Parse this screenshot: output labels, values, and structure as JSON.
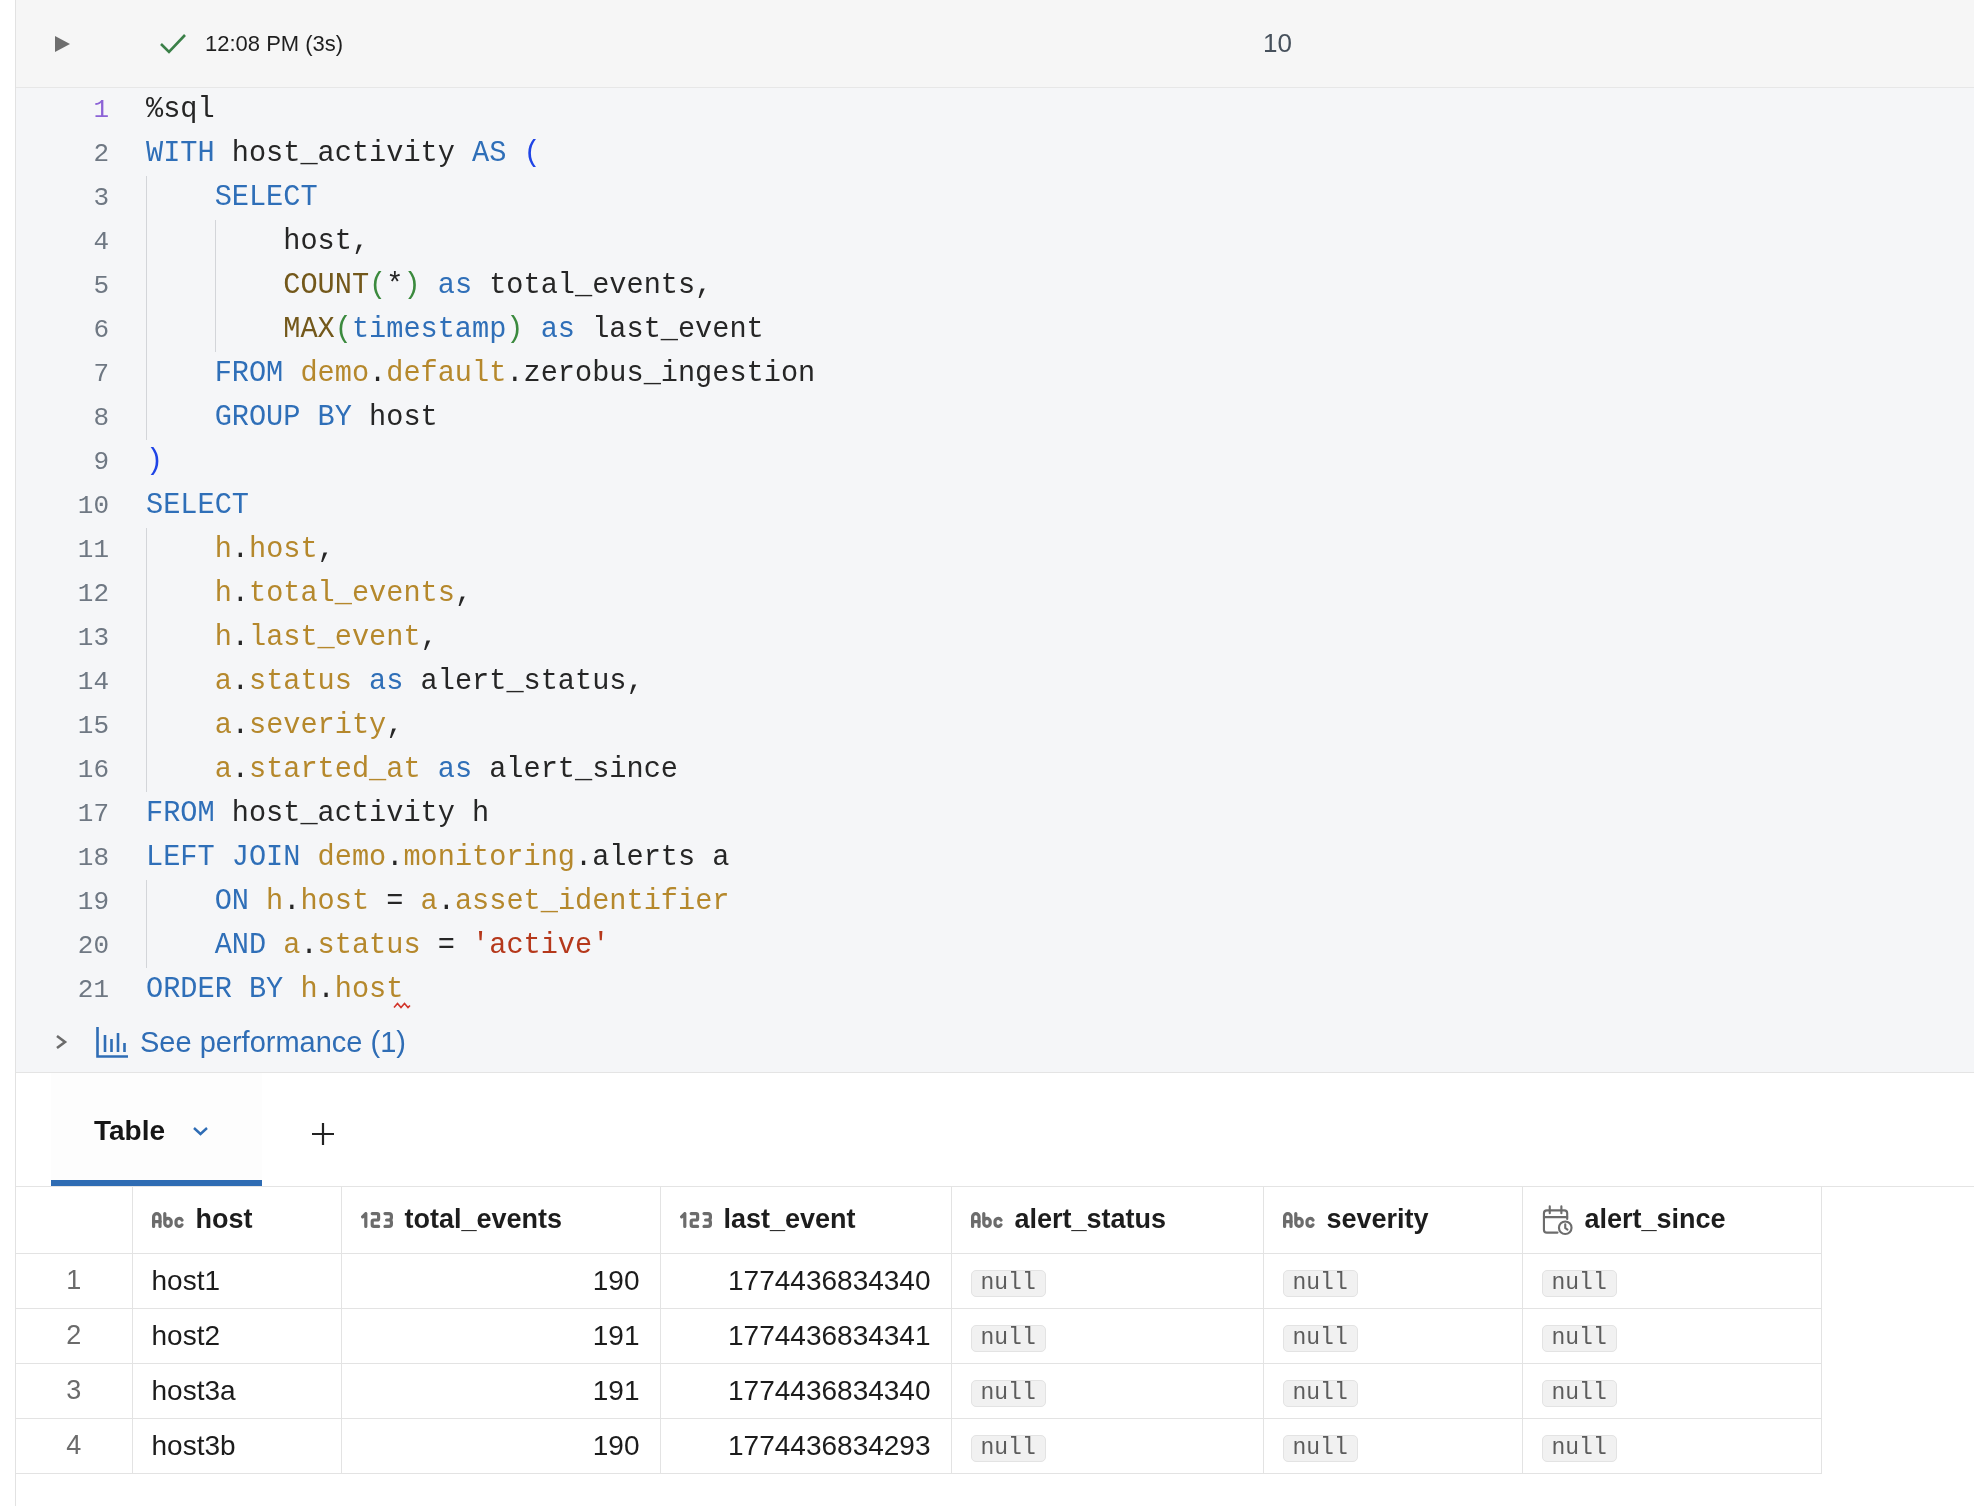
{
  "run_bar": {
    "success": true,
    "time": "12:08 PM (3s)",
    "trailing_text": "10"
  },
  "editor": {
    "lines": [
      {
        "number": "1",
        "highlighted": true,
        "error": false,
        "tokens": [
          {
            "kind": "plain",
            "text": "%sql"
          }
        ]
      },
      {
        "number": "2",
        "highlighted": false,
        "error": false,
        "tokens": [
          {
            "kind": "keyword",
            "text": "WITH"
          },
          {
            "kind": "plain",
            "text": " host_activity "
          },
          {
            "kind": "keyword",
            "text": "AS "
          },
          {
            "kind": "bracket",
            "text": "("
          }
        ]
      },
      {
        "number": "3",
        "highlighted": false,
        "error": false,
        "tokens": [
          {
            "kind": "indent"
          },
          {
            "kind": "keyword",
            "text": "SELECT"
          }
        ]
      },
      {
        "number": "4",
        "highlighted": false,
        "error": false,
        "tokens": [
          {
            "kind": "indent"
          },
          {
            "kind": "indent"
          },
          {
            "kind": "plain",
            "text": "host,"
          }
        ]
      },
      {
        "number": "5",
        "highlighted": false,
        "error": false,
        "tokens": [
          {
            "kind": "indent"
          },
          {
            "kind": "indent"
          },
          {
            "kind": "function",
            "text": "COUNT"
          },
          {
            "kind": "delimiter",
            "text": "("
          },
          {
            "kind": "plain",
            "text": "*"
          },
          {
            "kind": "delimiter",
            "text": ")"
          },
          {
            "kind": "keyword",
            "text": " as"
          },
          {
            "kind": "plain",
            "text": " total_events,"
          }
        ]
      },
      {
        "number": "6",
        "highlighted": false,
        "error": false,
        "tokens": [
          {
            "kind": "indent"
          },
          {
            "kind": "indent"
          },
          {
            "kind": "function",
            "text": "MAX"
          },
          {
            "kind": "delimiter",
            "text": "("
          },
          {
            "kind": "keyword",
            "text": "timestamp"
          },
          {
            "kind": "delimiter",
            "text": ")"
          },
          {
            "kind": "keyword",
            "text": " as"
          },
          {
            "kind": "plain",
            "text": " last_event"
          }
        ]
      },
      {
        "number": "7",
        "highlighted": false,
        "error": false,
        "tokens": [
          {
            "kind": "indent"
          },
          {
            "kind": "keyword",
            "text": "FROM "
          },
          {
            "kind": "name",
            "text": "demo"
          },
          {
            "kind": "plain",
            "text": "."
          },
          {
            "kind": "name",
            "text": "default"
          },
          {
            "kind": "plain",
            "text": ".zerobus_ingestion"
          }
        ]
      },
      {
        "number": "8",
        "highlighted": false,
        "error": false,
        "tokens": [
          {
            "kind": "indent"
          },
          {
            "kind": "keyword",
            "text": "GROUP BY"
          },
          {
            "kind": "plain",
            "text": " host"
          }
        ]
      },
      {
        "number": "9",
        "highlighted": false,
        "error": false,
        "tokens": [
          {
            "kind": "bracket",
            "text": ")"
          }
        ]
      },
      {
        "number": "10",
        "highlighted": false,
        "error": false,
        "tokens": [
          {
            "kind": "keyword",
            "text": "SELECT"
          }
        ]
      },
      {
        "number": "11",
        "highlighted": false,
        "error": false,
        "tokens": [
          {
            "kind": "indent"
          },
          {
            "kind": "name",
            "text": "h"
          },
          {
            "kind": "plain",
            "text": "."
          },
          {
            "kind": "name",
            "text": "host"
          },
          {
            "kind": "plain",
            "text": ","
          }
        ]
      },
      {
        "number": "12",
        "highlighted": false,
        "error": false,
        "tokens": [
          {
            "kind": "indent"
          },
          {
            "kind": "name",
            "text": "h"
          },
          {
            "kind": "plain",
            "text": "."
          },
          {
            "kind": "name",
            "text": "total_events"
          },
          {
            "kind": "plain",
            "text": ","
          }
        ]
      },
      {
        "number": "13",
        "highlighted": false,
        "error": false,
        "tokens": [
          {
            "kind": "indent"
          },
          {
            "kind": "name",
            "text": "h"
          },
          {
            "kind": "plain",
            "text": "."
          },
          {
            "kind": "name",
            "text": "last_event"
          },
          {
            "kind": "plain",
            "text": ","
          }
        ]
      },
      {
        "number": "14",
        "highlighted": false,
        "error": false,
        "tokens": [
          {
            "kind": "indent"
          },
          {
            "kind": "name",
            "text": "a"
          },
          {
            "kind": "plain",
            "text": "."
          },
          {
            "kind": "name",
            "text": "status"
          },
          {
            "kind": "keyword",
            "text": " as"
          },
          {
            "kind": "plain",
            "text": " alert_status,"
          }
        ]
      },
      {
        "number": "15",
        "highlighted": false,
        "error": false,
        "tokens": [
          {
            "kind": "indent"
          },
          {
            "kind": "name",
            "text": "a"
          },
          {
            "kind": "plain",
            "text": "."
          },
          {
            "kind": "name",
            "text": "severity"
          },
          {
            "kind": "plain",
            "text": ","
          }
        ]
      },
      {
        "number": "16",
        "highlighted": false,
        "error": false,
        "tokens": [
          {
            "kind": "indent"
          },
          {
            "kind": "name",
            "text": "a"
          },
          {
            "kind": "plain",
            "text": "."
          },
          {
            "kind": "name",
            "text": "started_at"
          },
          {
            "kind": "keyword",
            "text": " as"
          },
          {
            "kind": "plain",
            "text": " alert_since"
          }
        ]
      },
      {
        "number": "17",
        "highlighted": false,
        "error": false,
        "tokens": [
          {
            "kind": "keyword",
            "text": "FROM"
          },
          {
            "kind": "plain",
            "text": " host_activity h"
          }
        ]
      },
      {
        "number": "18",
        "highlighted": false,
        "error": false,
        "tokens": [
          {
            "kind": "keyword",
            "text": "LEFT JOIN "
          },
          {
            "kind": "name",
            "text": "demo"
          },
          {
            "kind": "plain",
            "text": "."
          },
          {
            "kind": "name",
            "text": "monitoring"
          },
          {
            "kind": "plain",
            "text": ".alerts a"
          }
        ]
      },
      {
        "number": "19",
        "highlighted": false,
        "error": false,
        "tokens": [
          {
            "kind": "indent"
          },
          {
            "kind": "keyword",
            "text": "ON "
          },
          {
            "kind": "name",
            "text": "h"
          },
          {
            "kind": "plain",
            "text": "."
          },
          {
            "kind": "name",
            "text": "host"
          },
          {
            "kind": "plain",
            "text": " = "
          },
          {
            "kind": "name",
            "text": "a"
          },
          {
            "kind": "plain",
            "text": "."
          },
          {
            "kind": "name",
            "text": "asset_identifier"
          }
        ]
      },
      {
        "number": "20",
        "highlighted": false,
        "error": false,
        "tokens": [
          {
            "kind": "indent"
          },
          {
            "kind": "keyword",
            "text": "AND "
          },
          {
            "kind": "name",
            "text": "a"
          },
          {
            "kind": "plain",
            "text": "."
          },
          {
            "kind": "name",
            "text": "status"
          },
          {
            "kind": "plain",
            "text": " = "
          },
          {
            "kind": "string",
            "text": "'active'"
          }
        ]
      },
      {
        "number": "21",
        "highlighted": false,
        "error": true,
        "tokens": [
          {
            "kind": "keyword",
            "text": "ORDER BY "
          },
          {
            "kind": "name",
            "text": "h"
          },
          {
            "kind": "plain",
            "text": "."
          },
          {
            "kind": "name",
            "text": "host"
          }
        ]
      }
    ]
  },
  "performance": {
    "label": "See performance (1)",
    "expanded": false
  },
  "results": {
    "tabs": [
      {
        "label": "Table",
        "selected": true
      }
    ],
    "table": {
      "columns": [
        {
          "label": "host",
          "kind": "string"
        },
        {
          "label": "total_events",
          "kind": "number"
        },
        {
          "label": "last_event",
          "kind": "number"
        },
        {
          "label": "alert_status",
          "kind": "string"
        },
        {
          "label": "severity",
          "kind": "string"
        },
        {
          "label": "alert_since",
          "kind": "timestamp"
        }
      ],
      "rows": [
        {
          "number": "1",
          "cells": [
            {
              "kind": "value",
              "text": "host1"
            },
            {
              "kind": "value",
              "text": "190"
            },
            {
              "kind": "value",
              "text": "1774436834340"
            },
            {
              "kind": "null",
              "text": "null"
            },
            {
              "kind": "null",
              "text": "null"
            },
            {
              "kind": "null",
              "text": "null"
            }
          ]
        },
        {
          "number": "2",
          "cells": [
            {
              "kind": "value",
              "text": "host2"
            },
            {
              "kind": "value",
              "text": "191"
            },
            {
              "kind": "value",
              "text": "1774436834341"
            },
            {
              "kind": "null",
              "text": "null"
            },
            {
              "kind": "null",
              "text": "null"
            },
            {
              "kind": "null",
              "text": "null"
            }
          ]
        },
        {
          "number": "3",
          "cells": [
            {
              "kind": "value",
              "text": "host3a"
            },
            {
              "kind": "value",
              "text": "191"
            },
            {
              "kind": "value",
              "text": "1774436834340"
            },
            {
              "kind": "null",
              "text": "null"
            },
            {
              "kind": "null",
              "text": "null"
            },
            {
              "kind": "null",
              "text": "null"
            }
          ]
        },
        {
          "number": "4",
          "cells": [
            {
              "kind": "value",
              "text": "host3b"
            },
            {
              "kind": "value",
              "text": "190"
            },
            {
              "kind": "value",
              "text": "1774436834293"
            },
            {
              "kind": "null",
              "text": "null"
            },
            {
              "kind": "null",
              "text": "null"
            },
            {
              "kind": "null",
              "text": "null"
            }
          ]
        }
      ]
    }
  }
}
